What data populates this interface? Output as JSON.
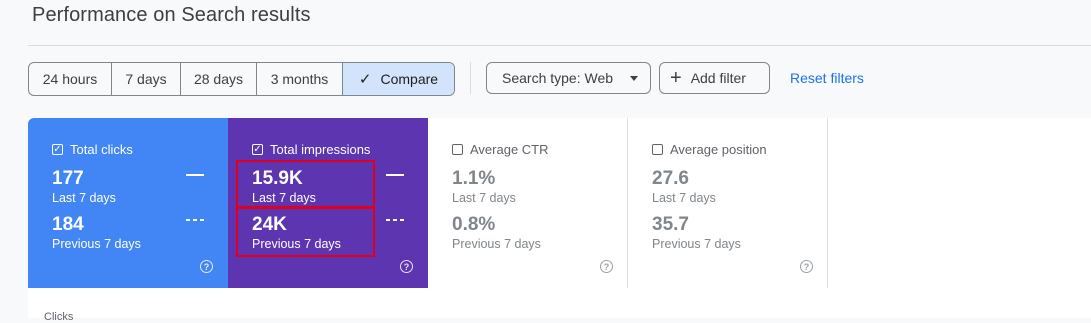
{
  "page": {
    "title": "Performance on Search results"
  },
  "toolbar": {
    "ranges": [
      "24 hours",
      "7 days",
      "28 days",
      "3 months",
      "Compare"
    ],
    "search_type": "Search type: Web",
    "add_filter": "Add filter",
    "reset": "Reset filters"
  },
  "cards": [
    {
      "label": "Total clicks",
      "checked": true,
      "v1": "177",
      "l1": "Last 7 days",
      "v2": "184",
      "l2": "Previous 7 days",
      "color": "#4285f4"
    },
    {
      "label": "Total impressions",
      "checked": true,
      "v1": "15.9K",
      "l1": "Last 7 days",
      "v2": "24K",
      "l2": "Previous 7 days",
      "color": "#5e35b1"
    },
    {
      "label": "Average CTR",
      "checked": false,
      "v1": "1.1%",
      "l1": "Last 7 days",
      "v2": "0.8%",
      "l2": "Previous 7 days"
    },
    {
      "label": "Average position",
      "checked": false,
      "v1": "27.6",
      "l1": "Last 7 days",
      "v2": "35.7",
      "l2": "Previous 7 days"
    }
  ],
  "chart": {
    "label": "Clicks"
  },
  "colors": {
    "accent": "#1a73e8",
    "highlight": "#e0001b"
  }
}
